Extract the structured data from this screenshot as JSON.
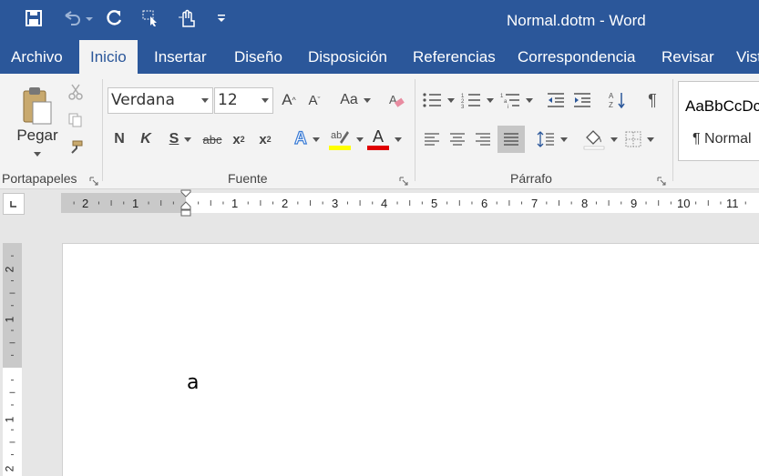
{
  "window": {
    "title": "Normal.dotm - Word"
  },
  "quick_access": [
    {
      "name": "save-icon"
    },
    {
      "name": "undo-icon"
    },
    {
      "name": "redo-icon"
    },
    {
      "name": "select-icon"
    },
    {
      "name": "touch-mode-icon"
    },
    {
      "name": "customize-qat-icon"
    }
  ],
  "tabs": [
    "Archivo",
    "Inicio",
    "Insertar",
    "Diseño",
    "Disposición",
    "Referencias",
    "Correspondencia",
    "Revisar",
    "Vista"
  ],
  "active_tab": "Inicio",
  "ribbon": {
    "clipboard": {
      "paste_label": "Pegar",
      "group_label": "Portapapeles"
    },
    "font": {
      "font_name": "Verdana",
      "font_size": "12",
      "group_label": "Fuente",
      "bold": "N",
      "italic": "K",
      "underline": "S",
      "strike": "abc",
      "sub": "x",
      "sub_small": "2",
      "sup": "x",
      "sup_small": "2",
      "case": "Aa",
      "grow": "A",
      "shrink": "A",
      "font_color_letter": "A",
      "effects_letter": "A",
      "highlight_color": "#ffff00",
      "font_color": "#e00000"
    },
    "paragraph": {
      "group_label": "Párrafo",
      "pilcrow": "¶"
    },
    "styles": {
      "sample": "AaBbCcDc",
      "style_name": "¶ Normal"
    }
  },
  "ruler": {
    "left_numbers": [
      "2",
      "1"
    ],
    "right_numbers": [
      "1",
      "2",
      "3",
      "4",
      "5",
      "6",
      "7",
      "8",
      "9",
      "10",
      "11"
    ],
    "vertical_numbers": [
      "2",
      "1",
      "1",
      "2"
    ]
  },
  "document": {
    "text": "a"
  },
  "colors": {
    "brand": "#2b579a",
    "ribbon": "#f3f3f3",
    "ruler_margin": "#c9c9c9"
  }
}
